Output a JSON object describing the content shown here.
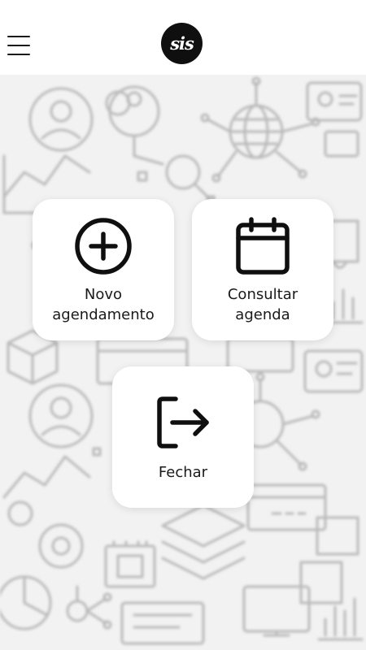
{
  "header": {
    "logo_text": "sis",
    "menu_icon": "hamburger-menu-icon"
  },
  "tiles": [
    {
      "id": "new",
      "label": "Novo\nagendamento",
      "icon": "plus-circle-icon"
    },
    {
      "id": "agenda",
      "label": "Consultar\nagenda",
      "icon": "calendar-icon"
    },
    {
      "id": "close",
      "label": "Fechar",
      "icon": "logout-icon"
    }
  ],
  "colors": {
    "icon": "#0f0f0f",
    "logo_bg": "#0f0f0f",
    "tile_bg": "#ffffff",
    "pattern_bg": "#f2f2f2",
    "pattern_stroke": "#b9b9b9"
  }
}
